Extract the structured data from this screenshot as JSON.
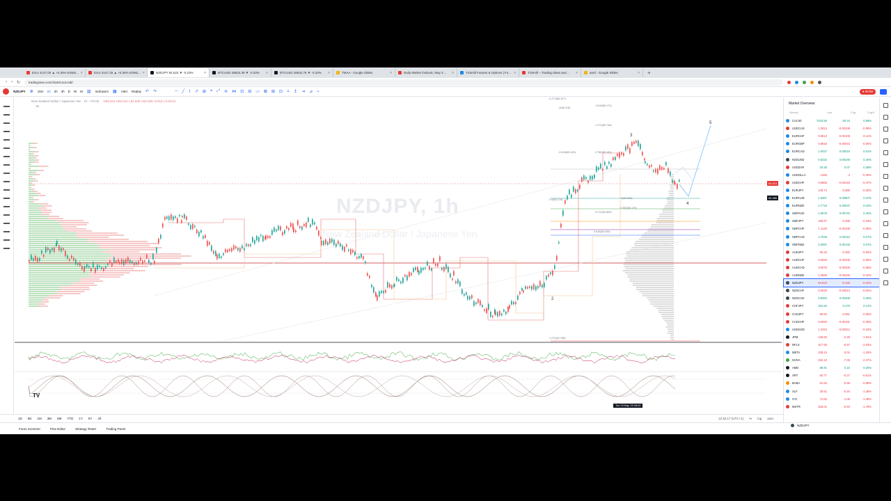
{
  "browser": {
    "tabs": [
      {
        "label": "ES1! 4147.00 ▲ +0.36% ESM2...",
        "color": "#e53935"
      },
      {
        "label": "ES1! 4147.25 ▲ +0.36% ESM2...",
        "color": "#e53935"
      },
      {
        "label": "NZDJPY 84.523 ▼ -0.23%",
        "color": "#131722",
        "active": true
      },
      {
        "label": "BTCUSD 28632.39 ▼ -0.33%",
        "color": "#131722"
      },
      {
        "label": "BTCUSD 28632.78 ▼ -0.33%",
        "color": "#131722"
      },
      {
        "label": "TMAA - Google Slides",
        "color": "#f4b400"
      },
      {
        "label": "Daily Market Outlook, May 3 ...",
        "color": "#e53935"
      },
      {
        "label": "Tickmill Futures & Options | Fu...",
        "color": "#1e88e5"
      },
      {
        "label": "Tickmill – Trading ideas and ...",
        "color": "#e53935"
      },
      {
        "label": "amd - Google Slides",
        "color": "#f4b400"
      }
    ],
    "new_tab": "+",
    "url": "tradingview.com/chart/L4cxcsdt/"
  },
  "toolbar": {
    "symbol": "NZDJPY",
    "intervals": [
      "15m",
      "1h",
      "2h",
      "4h",
      "D",
      "W",
      "M"
    ],
    "indicators_label": "Indicators",
    "alert_label": "Alert",
    "replay_label": "Replay",
    "rec_label": "● 00:59"
  },
  "chart": {
    "watermark_symbol": "NZDJPY, 1h",
    "watermark_name": "New Zealand Dollar / Japanese Yen",
    "legend": "New Zealand Dollar / Japanese Yen · 1h · FXCM",
    "legend_ohlc": "O84.541 H84.541 L84.508 C84.525 -0.012 (-0.01%)",
    "legend_sub": "15",
    "price_badge_current": "84.523",
    "price_badge_line": "84.386",
    "time_badge": "Tue 03 May '23 08:00",
    "tv_mark": "TV",
    "waves": [
      "3",
      "4",
      "5",
      "2"
    ],
    "fib_labels": [
      "-2.272(86.327)",
      "-2(86.116)",
      "1.618(86.172)",
      "1.272(85.748)",
      "0.786(85.169)",
      "-0.618(85.163)",
      "-0(84.836)",
      "0.5(84.176)",
      "0.382(84.123)",
      "0.272(83.863)",
      "0.618(83.426)",
      "1.272(81.158)"
    ],
    "series": {
      "candles_color_up": "#26a69a",
      "candles_color_down": "#ef5350",
      "volume_profile_up": "#66bb6a",
      "volume_profile_down": "#ef9a9a"
    }
  },
  "timeframes": {
    "items": [
      "1D",
      "5D",
      "1M",
      "3M",
      "6M",
      "YTD",
      "1Y",
      "5Y",
      "All"
    ],
    "clock": "12:42:17 (UTC+1)",
    "pct": "%",
    "log": "log",
    "auto": "auto"
  },
  "panels": {
    "items": [
      "Forex Screener",
      "Pine Editor",
      "Strategy Tester",
      "Trading Panel"
    ]
  },
  "watchlist": {
    "title": "Market Overview",
    "columns": [
      "Symbol",
      "Last",
      "Chg",
      "Chg%"
    ],
    "rows": [
      {
        "sym": "CAC40",
        "last": "7433.56",
        "chg": "50.44",
        "pct": "0.68%",
        "dir": "up",
        "dot": "#1e88e5"
      },
      {
        "sym": "USDCAD",
        "last": "1.3614",
        "chg": "-0.00108",
        "pct": "-0.08%",
        "dir": "down",
        "dot": "#e53935"
      },
      {
        "sym": "EURCHF",
        "last": "0.9812",
        "chg": "-0.00108",
        "pct": "-0.11%",
        "dir": "down",
        "dot": "#1e88e5"
      },
      {
        "sym": "EURGBP",
        "last": "0.8816",
        "chg": "-0.00044",
        "pct": "-0.05%",
        "dir": "down",
        "dot": "#1e88e5"
      },
      {
        "sym": "EURCAD",
        "last": "1.5027",
        "chg": "0.00019",
        "pct": "0.01%",
        "dir": "up",
        "dot": "#1e88e5"
      },
      {
        "sym": "NZDUSD",
        "last": "0.6232",
        "chg": "0.00249",
        "pct": "0.40%",
        "dir": "up",
        "dot": "#37474f"
      },
      {
        "sym": "USDZAR",
        "last": "18.26",
        "chg": "0.07",
        "pct": "0.38%",
        "dir": "up",
        "dot": "#e53935"
      },
      {
        "sym": "USDOLLA",
        "last": "1280",
        "chg": "-4",
        "pct": "-0.29%",
        "dir": "down",
        "dot": "#1e88e5"
      },
      {
        "sym": "USDCHF",
        "last": "0.8868",
        "chg": "-0.00418",
        "pct": "-0.47%",
        "dir": "down",
        "dot": "#e53935"
      },
      {
        "sym": "EURJPY",
        "last": "148.74",
        "chg": "-0.369",
        "pct": "-0.25%",
        "dir": "down",
        "dot": "#1e88e5"
      },
      {
        "sym": "EURAUD",
        "last": "1.6357",
        "chg": "0.00607",
        "pct": "0.37%",
        "dir": "up",
        "dot": "#1e88e5"
      },
      {
        "sym": "EURNZD",
        "last": "1.7718",
        "chg": "0.00037",
        "pct": "0.02%",
        "dir": "up",
        "dot": "#1e88e5"
      },
      {
        "sym": "GBPAUD",
        "last": "1.8578",
        "chg": "0.00734",
        "pct": "0.40%",
        "dir": "up",
        "dot": "#1e88e5"
      },
      {
        "sym": "GBPJPY",
        "last": "168.67",
        "chg": "-0.286",
        "pct": "-0.18%",
        "dir": "down",
        "dot": "#1e88e5"
      },
      {
        "sym": "GBPCHF",
        "last": "1.1129",
        "chg": "-0.00438",
        "pct": "-0.39%",
        "dir": "down",
        "dot": "#1e88e5"
      },
      {
        "sym": "GBPCAD",
        "last": "1.7045",
        "chg": "0.00112",
        "pct": "0.07%",
        "dir": "up",
        "dot": "#1e88e5"
      },
      {
        "sym": "GBPNZD",
        "last": "2.0097",
        "chg": "0.00133",
        "pct": "0.07%",
        "dir": "up",
        "dot": "#1e88e5"
      },
      {
        "sym": "AUDJPY",
        "last": "90.42",
        "chg": "-0.482",
        "pct": "-0.53%",
        "dir": "down",
        "dot": "#e53935"
      },
      {
        "sym": "AUDCHF",
        "last": "0.5925",
        "chg": "-0.00335",
        "pct": "-0.56%",
        "dir": "down",
        "dot": "#e53935"
      },
      {
        "sym": "AUDCAD",
        "last": "0.9078",
        "chg": "-0.00329",
        "pct": "-0.36%",
        "dir": "down",
        "dot": "#e53935"
      },
      {
        "sym": "AUDNZD",
        "last": "1.0690",
        "chg": "-0.00446",
        "pct": "-0.42%",
        "dir": "down",
        "dot": "#e53935"
      },
      {
        "sym": "NZDJPY",
        "last": "84.523",
        "chg": "-0.183",
        "pct": "-0.22%",
        "dir": "down",
        "dot": "#37474f",
        "selected": true
      },
      {
        "sym": "NZDCHF",
        "last": "0.5530",
        "chg": "-0.00013",
        "pct": "-0.02%",
        "dir": "down",
        "dot": "#37474f"
      },
      {
        "sym": "NZDCAD",
        "last": "0.8484",
        "chg": "0.00308",
        "pct": "0.36%",
        "dir": "up",
        "dot": "#37474f"
      },
      {
        "sym": "CHFJPY",
        "last": "152.84",
        "chg": "0.176",
        "pct": "0.12%",
        "dir": "up",
        "dot": "#e53935"
      },
      {
        "sym": "CADJPY",
        "last": "99.62",
        "chg": "-0.061",
        "pct": "-0.06%",
        "dir": "down",
        "dot": "#e53935"
      },
      {
        "sym": "CADCHF",
        "last": "0.6529",
        "chg": "-0.00191",
        "pct": "-0.29%",
        "dir": "down",
        "dot": "#e53935"
      },
      {
        "sym": "USDSGD",
        "last": "1.3310",
        "chg": "-0.00312",
        "pct": "-0.23%",
        "dir": "down",
        "dot": "#1e88e5"
      },
      {
        "sym": "JPM",
        "last": "138.92",
        "chg": "-2.28",
        "pct": "-1.61%",
        "dir": "down",
        "dot": "#131722"
      },
      {
        "sym": "NFLX",
        "last": "317.55",
        "chg": "-6.57",
        "pct": "-2.03%",
        "dir": "down",
        "dot": "#e53935"
      },
      {
        "sym": "META",
        "last": "239.24",
        "chg": "-3.04",
        "pct": "-1.25%",
        "dir": "down",
        "dot": "#1e88e5"
      },
      {
        "sym": "NVDA",
        "last": "282.10",
        "chg": "-7.06",
        "pct": "-2.47%",
        "dir": "down",
        "dot": "#43a047"
      },
      {
        "sym": "AMD",
        "last": "88.91",
        "chg": "0.22",
        "pct": "0.25%",
        "dir": "up",
        "dot": "#131722"
      },
      {
        "sym": "XRT",
        "last": "60.77",
        "chg": "-0.27",
        "pct": "-0.61%",
        "dir": "down",
        "dot": "#131722"
      },
      {
        "sym": "BABA",
        "last": "81.53",
        "chg": "-0.58",
        "pct": "-0.68%",
        "dir": "down",
        "dot": "#fb8c00"
      },
      {
        "sym": "XLF",
        "last": "30.51",
        "chg": "-0.44",
        "pct": "-1.39%",
        "dir": "down",
        "dot": "#1e88e5"
      },
      {
        "sym": "IYG",
        "last": "74.62",
        "chg": "-1.06",
        "pct": "-1.39%",
        "dir": "down",
        "dot": "#1e88e5"
      },
      {
        "sym": "MSTR",
        "last": "328.01",
        "chg": "-5.94",
        "pct": "-1.78%",
        "dir": "down",
        "dot": "#e53935"
      }
    ],
    "bottom_symbol": "NZDJPY"
  },
  "brand_big": "TV"
}
